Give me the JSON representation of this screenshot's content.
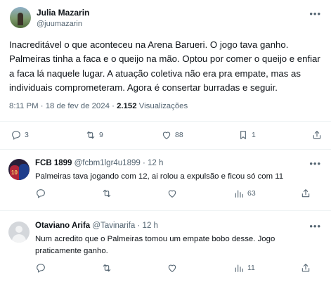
{
  "main_tweet": {
    "display_name": "Julia Mazarin",
    "handle": "@juumazarin",
    "more_icon": "more-horizontal-icon",
    "text": "Inacreditável o que aconteceu na Arena Barueri. O jogo tava ganho. Palmeiras tinha a faca e o queijo na mão. Optou por comer o queijo e enfiar a faca lá naquele lugar. A atuação coletiva não era pra empate, mas as individuais comprometeram. Agora é consertar burradas e seguir.",
    "time": "8:11 PM",
    "separator1": "·",
    "date": "18 de fev de 2024",
    "separator2": "·",
    "views_count": "2.152",
    "views_label": "Visualizações",
    "actions": {
      "reply_count": "3",
      "retweet_count": "9",
      "like_count": "88",
      "bookmark_count": "1"
    }
  },
  "replies": [
    {
      "display_name": "FCB 1899",
      "handle": "@fcbm1lgr4u1899",
      "separator": "·",
      "time": "12 h",
      "text": "Palmeiras tava jogando com 12, ai rolou a expulsão e ficou só com 11",
      "views": "63"
    },
    {
      "display_name": "Otaviano Arifa",
      "handle": "@Tavinarifa",
      "separator": "·",
      "time": "12 h",
      "text": "Num acredito que o Palmeiras tomou um empate bobo desse. Jogo praticamente ganho.",
      "views": "11"
    }
  ],
  "colors": {
    "text_primary": "#0f1419",
    "text_secondary": "#536471",
    "divider": "#eff3f4"
  }
}
